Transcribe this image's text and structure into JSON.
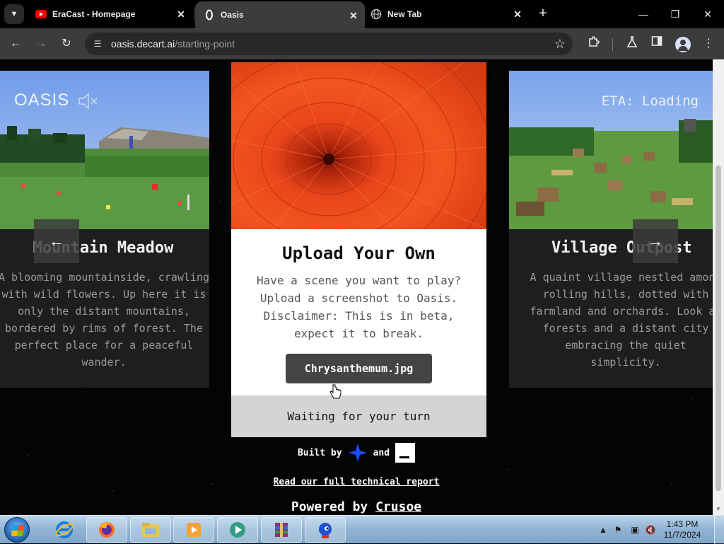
{
  "browser": {
    "tabs": [
      {
        "title": "EraCast - Homepage",
        "icon": "youtube-icon"
      },
      {
        "title": "Oasis",
        "icon": "oasis-icon"
      },
      {
        "title": "New Tab",
        "icon": "globe-icon"
      }
    ],
    "active_tab_index": 1,
    "url_host": "oasis.decart.ai",
    "url_path": "/starting-point"
  },
  "page": {
    "logo_text": "OASIS",
    "eta_text": "ETA: Loading",
    "left_card": {
      "title": "Mountain Meadow",
      "description": "A blooming mountainside, crawling with wild flowers. Up here it is only the distant mountains, bordered by rims of forest. The perfect place for a peaceful wander."
    },
    "center_card": {
      "title": "Upload Your Own",
      "description": "Have a scene you want to play? Upload a screenshot to Oasis. Disclaimer: This is in beta, expect it to break.",
      "file_button": "Chrysanthemum.jpg",
      "status": "Waiting for your turn"
    },
    "right_card": {
      "title": "Village Outpost",
      "description": "A quaint village nestled among rolling hills, dotted with farmland and orchards. Look at forests and a distant city embracing the quiet simplicity."
    },
    "footer": {
      "built_by": "Built by",
      "and": "and",
      "report_link": "Read our full technical report",
      "powered_by": "Powered by",
      "powered_by_brand": "Crusoe"
    }
  },
  "taskbar": {
    "time": "1:43 PM",
    "date": "11/7/2024"
  },
  "colors": {
    "chrome_bg": "#3c3c3c",
    "page_bg": "#040404",
    "button_bg": "#444444",
    "accent_blue": "#1a4cff"
  }
}
